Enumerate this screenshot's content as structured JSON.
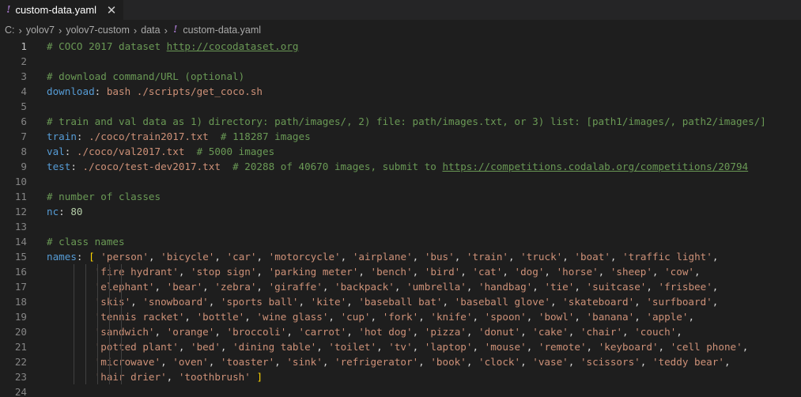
{
  "tab": {
    "icon": "!",
    "title": "custom-data.yaml",
    "close": "✕"
  },
  "breadcrumb": {
    "drive": "C:",
    "segments": [
      "yolov7",
      "yolov7-custom",
      "data"
    ],
    "file_icon": "!",
    "file": "custom-data.yaml"
  },
  "editor": {
    "active_line": 1,
    "lines": [
      {
        "n": "1",
        "tokens": [
          [
            "comment",
            "# COCO 2017 dataset "
          ],
          [
            "link",
            "http://cocodataset.org"
          ]
        ]
      },
      {
        "n": "2",
        "tokens": []
      },
      {
        "n": "3",
        "tokens": [
          [
            "comment",
            "# download command/URL (optional)"
          ]
        ]
      },
      {
        "n": "4",
        "tokens": [
          [
            "key",
            "download"
          ],
          [
            "punct",
            ": "
          ],
          [
            "val",
            "bash ./scripts/get_coco.sh"
          ]
        ]
      },
      {
        "n": "5",
        "tokens": []
      },
      {
        "n": "6",
        "tokens": [
          [
            "comment",
            "# train and val data as 1) directory: path/images/, 2) file: path/images.txt, or 3) list: [path1/images/, path2/images/]"
          ]
        ]
      },
      {
        "n": "7",
        "tokens": [
          [
            "key",
            "train"
          ],
          [
            "punct",
            ": "
          ],
          [
            "val",
            "./coco/train2017.txt"
          ],
          [
            "punct",
            "  "
          ],
          [
            "comment",
            "# 118287 images"
          ]
        ]
      },
      {
        "n": "8",
        "tokens": [
          [
            "key",
            "val"
          ],
          [
            "punct",
            ": "
          ],
          [
            "val",
            "./coco/val2017.txt"
          ],
          [
            "punct",
            "  "
          ],
          [
            "comment",
            "# 5000 images"
          ]
        ]
      },
      {
        "n": "9",
        "tokens": [
          [
            "key",
            "test"
          ],
          [
            "punct",
            ": "
          ],
          [
            "val",
            "./coco/test-dev2017.txt"
          ],
          [
            "punct",
            "  "
          ],
          [
            "comment",
            "# 20288 of 40670 images, submit to "
          ],
          [
            "link",
            "https://competitions.codalab.org/competitions/20794"
          ]
        ]
      },
      {
        "n": "10",
        "tokens": []
      },
      {
        "n": "11",
        "tokens": [
          [
            "comment",
            "# number of classes"
          ]
        ]
      },
      {
        "n": "12",
        "tokens": [
          [
            "key",
            "nc"
          ],
          [
            "punct",
            ": "
          ],
          [
            "num",
            "80"
          ]
        ]
      },
      {
        "n": "13",
        "tokens": []
      },
      {
        "n": "14",
        "tokens": [
          [
            "comment",
            "# class names"
          ]
        ]
      },
      {
        "n": "15",
        "tokens": [
          [
            "key",
            "names"
          ],
          [
            "punct",
            ": "
          ],
          [
            "bracket",
            "["
          ],
          [
            "punct",
            " "
          ],
          [
            "str",
            "'person'"
          ],
          [
            "punct",
            ", "
          ],
          [
            "str",
            "'bicycle'"
          ],
          [
            "punct",
            ", "
          ],
          [
            "str",
            "'car'"
          ],
          [
            "punct",
            ", "
          ],
          [
            "str",
            "'motorcycle'"
          ],
          [
            "punct",
            ", "
          ],
          [
            "str",
            "'airplane'"
          ],
          [
            "punct",
            ", "
          ],
          [
            "str",
            "'bus'"
          ],
          [
            "punct",
            ", "
          ],
          [
            "str",
            "'train'"
          ],
          [
            "punct",
            ", "
          ],
          [
            "str",
            "'truck'"
          ],
          [
            "punct",
            ", "
          ],
          [
            "str",
            "'boat'"
          ],
          [
            "punct",
            ", "
          ],
          [
            "str",
            "'traffic light'"
          ],
          [
            "punct",
            ","
          ]
        ]
      },
      {
        "n": "16",
        "indent": true,
        "tokens": [
          [
            "str",
            "'fire hydrant'"
          ],
          [
            "punct",
            ", "
          ],
          [
            "str",
            "'stop sign'"
          ],
          [
            "punct",
            ", "
          ],
          [
            "str",
            "'parking meter'"
          ],
          [
            "punct",
            ", "
          ],
          [
            "str",
            "'bench'"
          ],
          [
            "punct",
            ", "
          ],
          [
            "str",
            "'bird'"
          ],
          [
            "punct",
            ", "
          ],
          [
            "str",
            "'cat'"
          ],
          [
            "punct",
            ", "
          ],
          [
            "str",
            "'dog'"
          ],
          [
            "punct",
            ", "
          ],
          [
            "str",
            "'horse'"
          ],
          [
            "punct",
            ", "
          ],
          [
            "str",
            "'sheep'"
          ],
          [
            "punct",
            ", "
          ],
          [
            "str",
            "'cow'"
          ],
          [
            "punct",
            ","
          ]
        ]
      },
      {
        "n": "17",
        "indent": true,
        "tokens": [
          [
            "str",
            "'elephant'"
          ],
          [
            "punct",
            ", "
          ],
          [
            "str",
            "'bear'"
          ],
          [
            "punct",
            ", "
          ],
          [
            "str",
            "'zebra'"
          ],
          [
            "punct",
            ", "
          ],
          [
            "str",
            "'giraffe'"
          ],
          [
            "punct",
            ", "
          ],
          [
            "str",
            "'backpack'"
          ],
          [
            "punct",
            ", "
          ],
          [
            "str",
            "'umbrella'"
          ],
          [
            "punct",
            ", "
          ],
          [
            "str",
            "'handbag'"
          ],
          [
            "punct",
            ", "
          ],
          [
            "str",
            "'tie'"
          ],
          [
            "punct",
            ", "
          ],
          [
            "str",
            "'suitcase'"
          ],
          [
            "punct",
            ", "
          ],
          [
            "str",
            "'frisbee'"
          ],
          [
            "punct",
            ","
          ]
        ]
      },
      {
        "n": "18",
        "indent": true,
        "tokens": [
          [
            "str",
            "'skis'"
          ],
          [
            "punct",
            ", "
          ],
          [
            "str",
            "'snowboard'"
          ],
          [
            "punct",
            ", "
          ],
          [
            "str",
            "'sports ball'"
          ],
          [
            "punct",
            ", "
          ],
          [
            "str",
            "'kite'"
          ],
          [
            "punct",
            ", "
          ],
          [
            "str",
            "'baseball bat'"
          ],
          [
            "punct",
            ", "
          ],
          [
            "str",
            "'baseball glove'"
          ],
          [
            "punct",
            ", "
          ],
          [
            "str",
            "'skateboard'"
          ],
          [
            "punct",
            ", "
          ],
          [
            "str",
            "'surfboard'"
          ],
          [
            "punct",
            ","
          ]
        ]
      },
      {
        "n": "19",
        "indent": true,
        "tokens": [
          [
            "str",
            "'tennis racket'"
          ],
          [
            "punct",
            ", "
          ],
          [
            "str",
            "'bottle'"
          ],
          [
            "punct",
            ", "
          ],
          [
            "str",
            "'wine glass'"
          ],
          [
            "punct",
            ", "
          ],
          [
            "str",
            "'cup'"
          ],
          [
            "punct",
            ", "
          ],
          [
            "str",
            "'fork'"
          ],
          [
            "punct",
            ", "
          ],
          [
            "str",
            "'knife'"
          ],
          [
            "punct",
            ", "
          ],
          [
            "str",
            "'spoon'"
          ],
          [
            "punct",
            ", "
          ],
          [
            "str",
            "'bowl'"
          ],
          [
            "punct",
            ", "
          ],
          [
            "str",
            "'banana'"
          ],
          [
            "punct",
            ", "
          ],
          [
            "str",
            "'apple'"
          ],
          [
            "punct",
            ","
          ]
        ]
      },
      {
        "n": "20",
        "indent": true,
        "tokens": [
          [
            "str",
            "'sandwich'"
          ],
          [
            "punct",
            ", "
          ],
          [
            "str",
            "'orange'"
          ],
          [
            "punct",
            ", "
          ],
          [
            "str",
            "'broccoli'"
          ],
          [
            "punct",
            ", "
          ],
          [
            "str",
            "'carrot'"
          ],
          [
            "punct",
            ", "
          ],
          [
            "str",
            "'hot dog'"
          ],
          [
            "punct",
            ", "
          ],
          [
            "str",
            "'pizza'"
          ],
          [
            "punct",
            ", "
          ],
          [
            "str",
            "'donut'"
          ],
          [
            "punct",
            ", "
          ],
          [
            "str",
            "'cake'"
          ],
          [
            "punct",
            ", "
          ],
          [
            "str",
            "'chair'"
          ],
          [
            "punct",
            ", "
          ],
          [
            "str",
            "'couch'"
          ],
          [
            "punct",
            ","
          ]
        ]
      },
      {
        "n": "21",
        "indent": true,
        "tokens": [
          [
            "str",
            "'potted plant'"
          ],
          [
            "punct",
            ", "
          ],
          [
            "str",
            "'bed'"
          ],
          [
            "punct",
            ", "
          ],
          [
            "str",
            "'dining table'"
          ],
          [
            "punct",
            ", "
          ],
          [
            "str",
            "'toilet'"
          ],
          [
            "punct",
            ", "
          ],
          [
            "str",
            "'tv'"
          ],
          [
            "punct",
            ", "
          ],
          [
            "str",
            "'laptop'"
          ],
          [
            "punct",
            ", "
          ],
          [
            "str",
            "'mouse'"
          ],
          [
            "punct",
            ", "
          ],
          [
            "str",
            "'remote'"
          ],
          [
            "punct",
            ", "
          ],
          [
            "str",
            "'keyboard'"
          ],
          [
            "punct",
            ", "
          ],
          [
            "str",
            "'cell phone'"
          ],
          [
            "punct",
            ","
          ]
        ]
      },
      {
        "n": "22",
        "indent": true,
        "tokens": [
          [
            "str",
            "'microwave'"
          ],
          [
            "punct",
            ", "
          ],
          [
            "str",
            "'oven'"
          ],
          [
            "punct",
            ", "
          ],
          [
            "str",
            "'toaster'"
          ],
          [
            "punct",
            ", "
          ],
          [
            "str",
            "'sink'"
          ],
          [
            "punct",
            ", "
          ],
          [
            "str",
            "'refrigerator'"
          ],
          [
            "punct",
            ", "
          ],
          [
            "str",
            "'book'"
          ],
          [
            "punct",
            ", "
          ],
          [
            "str",
            "'clock'"
          ],
          [
            "punct",
            ", "
          ],
          [
            "str",
            "'vase'"
          ],
          [
            "punct",
            ", "
          ],
          [
            "str",
            "'scissors'"
          ],
          [
            "punct",
            ", "
          ],
          [
            "str",
            "'teddy bear'"
          ],
          [
            "punct",
            ","
          ]
        ]
      },
      {
        "n": "23",
        "indent": true,
        "tokens": [
          [
            "str",
            "'hair drier'"
          ],
          [
            "punct",
            ", "
          ],
          [
            "str",
            "'toothbrush'"
          ],
          [
            "punct",
            " "
          ],
          [
            "bracket",
            "]"
          ]
        ]
      },
      {
        "n": "24",
        "tokens": []
      }
    ]
  },
  "colors": {
    "background": "#1e1e1e",
    "comment": "#6a9955",
    "key": "#569cd6",
    "string": "#ce9178",
    "number": "#b5cea8",
    "bracket": "#ffd700",
    "yaml_icon": "#a074c4"
  }
}
